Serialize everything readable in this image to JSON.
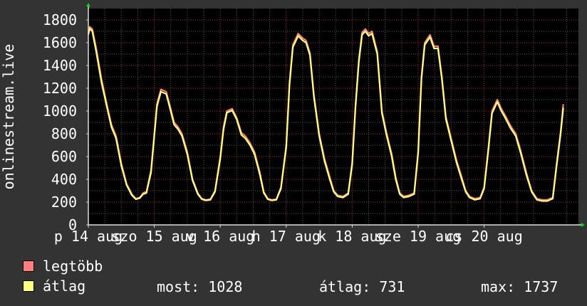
{
  "chart_data": {
    "type": "line",
    "title": "",
    "ylabel": "onlinestream.live",
    "xlabel": "",
    "ylim": [
      0,
      1900
    ],
    "yticks": [
      0,
      200,
      400,
      600,
      800,
      1000,
      1200,
      1400,
      1600,
      1800
    ],
    "x_tick_labels": [
      "p 14 aug",
      "szo 15 aug",
      "v 16 aug",
      "h 17 aug",
      "k 18 aug",
      "sze 19 aug",
      "cs 20 aug"
    ],
    "x_days": [
      14,
      15,
      16,
      17,
      18,
      19,
      20
    ],
    "xlim": [
      14,
      21.43
    ],
    "grid": true,
    "series": [
      {
        "name": "legtöbb",
        "color": "#ff7f7f",
        "x": [
          14.0,
          14.02,
          14.06,
          14.12,
          14.2,
          14.28,
          14.35,
          14.42,
          14.5,
          14.58,
          14.66,
          14.72,
          14.78,
          14.83,
          14.88,
          14.95,
          15.0,
          15.04,
          15.1,
          15.18,
          15.24,
          15.3,
          15.36,
          15.42,
          15.5,
          15.58,
          15.66,
          15.72,
          15.78,
          15.85,
          15.92,
          16.0,
          16.05,
          16.1,
          16.18,
          16.25,
          16.32,
          16.38,
          16.45,
          16.52,
          16.6,
          16.66,
          16.72,
          16.78,
          16.85,
          16.92,
          17.0,
          17.05,
          17.1,
          17.18,
          17.25,
          17.3,
          17.36,
          17.42,
          17.5,
          17.58,
          17.66,
          17.72,
          17.78,
          17.86,
          17.94,
          18.0,
          18.05,
          18.1,
          18.15,
          18.2,
          18.25,
          18.3,
          18.38,
          18.45,
          18.52,
          18.6,
          18.66,
          18.72,
          18.78,
          18.86,
          18.94,
          19.0,
          19.05,
          19.1,
          19.18,
          19.24,
          19.3,
          19.36,
          19.42,
          19.5,
          19.58,
          19.66,
          19.72,
          19.78,
          19.86,
          19.94,
          20.0,
          20.06,
          20.12,
          20.2,
          20.26,
          20.32,
          20.4,
          20.48,
          20.56,
          20.64,
          20.72,
          20.8,
          20.88,
          20.96,
          21.04,
          21.1,
          21.16,
          21.2
        ],
        "values": [
          1690,
          1740,
          1720,
          1550,
          1280,
          1060,
          880,
          780,
          540,
          360,
          270,
          230,
          240,
          280,
          290,
          480,
          800,
          1060,
          1190,
          1170,
          1040,
          900,
          860,
          800,
          640,
          400,
          280,
          230,
          220,
          225,
          300,
          600,
          860,
          1000,
          1020,
          940,
          810,
          780,
          720,
          640,
          460,
          290,
          230,
          220,
          225,
          330,
          700,
          1250,
          1580,
          1680,
          1640,
          1620,
          1510,
          1140,
          800,
          580,
          420,
          300,
          260,
          250,
          280,
          550,
          1050,
          1450,
          1690,
          1720,
          1680,
          1700,
          1520,
          1000,
          810,
          620,
          420,
          280,
          250,
          260,
          280,
          650,
          1300,
          1600,
          1670,
          1570,
          1570,
          1300,
          950,
          760,
          570,
          420,
          300,
          250,
          230,
          240,
          330,
          650,
          1000,
          1100,
          1020,
          960,
          870,
          800,
          640,
          460,
          300,
          230,
          220,
          220,
          240,
          540,
          820,
          1060
        ]
      },
      {
        "name": "átlag",
        "color": "#ffff80",
        "x": [
          14.0,
          14.02,
          14.06,
          14.12,
          14.2,
          14.28,
          14.35,
          14.42,
          14.5,
          14.58,
          14.66,
          14.72,
          14.78,
          14.83,
          14.88,
          14.95,
          15.0,
          15.04,
          15.1,
          15.18,
          15.24,
          15.3,
          15.36,
          15.42,
          15.5,
          15.58,
          15.66,
          15.72,
          15.78,
          15.85,
          15.92,
          16.0,
          16.05,
          16.1,
          16.18,
          16.25,
          16.32,
          16.38,
          16.45,
          16.52,
          16.6,
          16.66,
          16.72,
          16.78,
          16.85,
          16.92,
          17.0,
          17.05,
          17.1,
          17.18,
          17.25,
          17.3,
          17.36,
          17.42,
          17.5,
          17.58,
          17.66,
          17.72,
          17.78,
          17.86,
          17.94,
          18.0,
          18.05,
          18.1,
          18.15,
          18.2,
          18.25,
          18.3,
          18.38,
          18.45,
          18.52,
          18.6,
          18.66,
          18.72,
          18.78,
          18.86,
          18.94,
          19.0,
          19.05,
          19.1,
          19.18,
          19.24,
          19.3,
          19.36,
          19.42,
          19.5,
          19.58,
          19.66,
          19.72,
          19.78,
          19.86,
          19.94,
          20.0,
          20.06,
          20.12,
          20.2,
          20.26,
          20.32,
          20.4,
          20.48,
          20.56,
          20.64,
          20.72,
          20.8,
          20.88,
          20.96,
          21.04,
          21.1,
          21.16,
          21.2
        ],
        "values": [
          1670,
          1725,
          1700,
          1520,
          1250,
          1040,
          860,
          760,
          520,
          350,
          260,
          225,
          235,
          270,
          280,
          460,
          780,
          1040,
          1170,
          1150,
          1020,
          880,
          840,
          780,
          620,
          390,
          270,
          225,
          215,
          220,
          290,
          580,
          840,
          985,
          1005,
          925,
          790,
          760,
          700,
          620,
          440,
          280,
          225,
          215,
          220,
          320,
          680,
          1230,
          1560,
          1660,
          1620,
          1600,
          1490,
          1120,
          780,
          560,
          400,
          290,
          250,
          240,
          270,
          530,
          1030,
          1430,
          1670,
          1700,
          1660,
          1680,
          1500,
          980,
          790,
          600,
          400,
          270,
          240,
          250,
          270,
          630,
          1280,
          1580,
          1650,
          1550,
          1550,
          1280,
          930,
          740,
          550,
          400,
          290,
          240,
          220,
          230,
          320,
          630,
          980,
          1080,
          1000,
          940,
          850,
          780,
          620,
          440,
          290,
          220,
          210,
          210,
          230,
          520,
          800,
          1028
        ]
      }
    ]
  },
  "legend": [
    {
      "label": "legtöbb",
      "color": "#ff7f7f"
    },
    {
      "label": "átlag",
      "color": "#ffff80"
    }
  ],
  "stats": {
    "now": "most: 1028",
    "avg": "átlag: 731",
    "max": "max: 1737"
  }
}
